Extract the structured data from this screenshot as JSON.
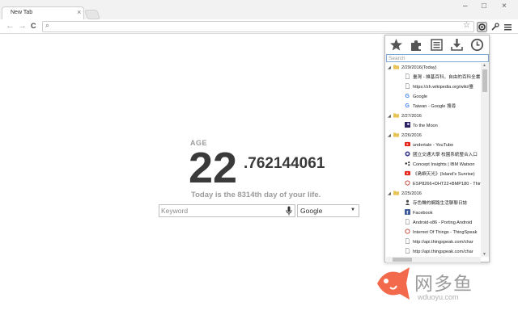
{
  "browser": {
    "tab_title": "New Tab",
    "tab_close": "×",
    "window_controls": {
      "minimize": "–",
      "maximize": "□",
      "close": "×"
    },
    "nav": {
      "back": "←",
      "forward": "→",
      "reload": "C"
    },
    "omnibox": {
      "value": "",
      "placeholder": ""
    },
    "extensions": [
      "bookmark-history-extension-icon",
      "tools-icon",
      "menu-icon"
    ]
  },
  "main": {
    "age_label": "AGE",
    "age_integer": "22",
    "age_decimal": ".762144061",
    "day_line": "Today is the 8314th day of your life.",
    "keyword_placeholder": "Keyword",
    "search_engine": "Google"
  },
  "popup": {
    "toolbar_icons": [
      "star-icon",
      "puzzle-icon",
      "notes-icon",
      "download-icon",
      "clock-icon"
    ],
    "search_placeholder": "Search",
    "rows": [
      {
        "kind": "folder",
        "label": "2/29/2016(Today)"
      },
      {
        "kind": "item",
        "icon": "page",
        "label": "臺灣 - 維基百科，自由的百科全書"
      },
      {
        "kind": "item",
        "icon": "page",
        "label": "https://zh.wikipedia.org/wiki/臺"
      },
      {
        "kind": "item",
        "icon": "google",
        "label": "Google"
      },
      {
        "kind": "item",
        "icon": "google",
        "label": "Taiwan - Google 搜尋"
      },
      {
        "kind": "folder",
        "label": "2/27/2016"
      },
      {
        "kind": "item",
        "icon": "moon",
        "label": "To the Moon"
      },
      {
        "kind": "folder",
        "label": "2/26/2016"
      },
      {
        "kind": "item",
        "icon": "youtube",
        "label": "undertale - YouTube"
      },
      {
        "kind": "item",
        "icon": "circle",
        "label": "國立交通大學 校園系統整合入口"
      },
      {
        "kind": "item",
        "icon": "dots",
        "label": "Concept Insights | IBM Watson"
      },
      {
        "kind": "item",
        "icon": "youtube",
        "label": "《島嶼天光》(Island's Sunrise)"
      },
      {
        "kind": "item",
        "icon": "ring",
        "label": "ESP8266+DHT22+BMP180 - Thing"
      },
      {
        "kind": "folder",
        "label": "2/25/2016"
      },
      {
        "kind": "item",
        "icon": "person",
        "label": "存色聲的網路生活聊聊日誌"
      },
      {
        "kind": "item",
        "icon": "facebook",
        "label": "Facebook"
      },
      {
        "kind": "item",
        "icon": "page",
        "label": "Android-x86 - Porting Android"
      },
      {
        "kind": "item",
        "icon": "ring",
        "label": "Internet Of Things - ThingSpeak"
      },
      {
        "kind": "item",
        "icon": "page",
        "label": "http://api.thingspeak.com/char"
      },
      {
        "kind": "item",
        "icon": "page",
        "label": "http://api.thingspeak.com/char"
      }
    ]
  },
  "watermark": {
    "text": "网多鱼",
    "url": "wduoyu.com"
  },
  "colors": {
    "age_text": "#3a3a3a",
    "label_grey": "#9b9b9b",
    "folder": "#e8c35a",
    "youtube": "#e62117",
    "facebook": "#3b5998",
    "google_blue": "#4285f4",
    "watermark_fish": "#f26a4b"
  }
}
